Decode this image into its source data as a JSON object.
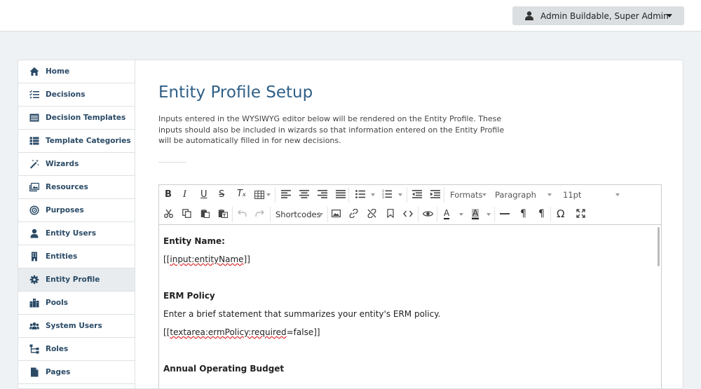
{
  "header": {
    "user_label": "Admin Buildable, Super Admin"
  },
  "sidebar": {
    "items": [
      {
        "label": "Home",
        "icon": "home-icon"
      },
      {
        "label": "Decisions",
        "icon": "list-check-icon"
      },
      {
        "label": "Decision Templates",
        "icon": "template-icon"
      },
      {
        "label": "Template Categories",
        "icon": "table-list-icon"
      },
      {
        "label": "Wizards",
        "icon": "magic-wand-icon"
      },
      {
        "label": "Resources",
        "icon": "images-icon"
      },
      {
        "label": "Purposes",
        "icon": "target-icon"
      },
      {
        "label": "Entity Users",
        "icon": "user-icon"
      },
      {
        "label": "Entities",
        "icon": "building-icon"
      },
      {
        "label": "Entity Profile",
        "icon": "gear-icon",
        "active": true
      },
      {
        "label": "Pools",
        "icon": "city-icon"
      },
      {
        "label": "System Users",
        "icon": "users-icon"
      },
      {
        "label": "Roles",
        "icon": "sitemap-icon"
      },
      {
        "label": "Pages",
        "icon": "page-icon"
      }
    ]
  },
  "main": {
    "title": "Entity Profile Setup",
    "description_lines": [
      "Inputs entered in the WYSIWYG editor below will be rendered on the Entity Profile. These",
      "inputs should also be included in wizards so that information entered on the Entity Profile",
      "will be automatically filled in for new decisions."
    ]
  },
  "editor": {
    "toolbar": {
      "formats": "Formats",
      "block": "Paragraph",
      "font_size": "11pt",
      "shortcodes": "Shortcodes"
    },
    "content": {
      "entity_name_heading": "Entity Name:",
      "entity_name_open": "[[",
      "entity_name_code": "input:entityName",
      "entity_name_close": "]]",
      "erm_heading": "ERM Policy",
      "erm_text": "Enter a brief statement that summarizes your entity's ERM policy.",
      "erm_open": "[[",
      "erm_code": "textarea:ermPolicy:required",
      "erm_close": "=false]]",
      "budget_heading": "Annual Operating Budget"
    }
  }
}
